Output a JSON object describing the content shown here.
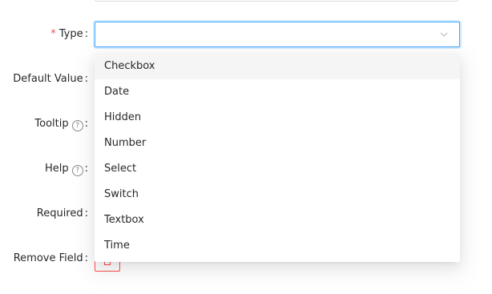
{
  "form": {
    "type": {
      "label": "Type",
      "required_mark": "*",
      "colon": ":",
      "value": ""
    },
    "default_value": {
      "label": "Default Value",
      "colon": ":"
    },
    "tooltip": {
      "label": "Tooltip",
      "help_glyph": "?",
      "colon": ":"
    },
    "help": {
      "label": "Help",
      "help_glyph": "?",
      "colon": ":"
    },
    "required": {
      "label": "Required",
      "colon": ":"
    },
    "remove_field": {
      "label": "Remove Field",
      "colon": ":"
    }
  },
  "dropdown": {
    "options": [
      "Checkbox",
      "Date",
      "Hidden",
      "Number",
      "Select",
      "Switch",
      "Textbox",
      "Time"
    ],
    "highlighted": "Checkbox"
  },
  "colors": {
    "accent": "#40a9ff",
    "danger": "#ff4d4f",
    "option_hover": "#f5f5f5"
  },
  "icons": {
    "select_arrow": "chevron-down-icon",
    "help": "question-circle-icon",
    "remove": "delete-icon"
  }
}
